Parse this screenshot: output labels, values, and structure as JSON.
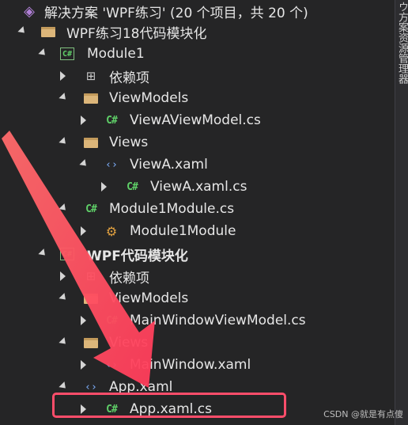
{
  "solution_title": "解决方案 'WPF练习' (20 个项目，共 20 个)",
  "side_panel_text": "ウ方案资源管理器",
  "tree": [
    {
      "id": "wpf18-project",
      "label": "WPF练习18代码模块化",
      "icon": "folder-icon",
      "arrow": "expanded",
      "bold": false
    },
    {
      "id": "module1-project",
      "label": "Module1",
      "icon": "csproj-icon",
      "arrow": "expanded",
      "bold": false
    },
    {
      "id": "module1-dependencies",
      "label": "依赖项",
      "icon": "dependencies-icon",
      "arrow": "collapsed",
      "bold": false
    },
    {
      "id": "module1-viewmodels",
      "label": "ViewModels",
      "icon": "folder-icon",
      "arrow": "expanded",
      "bold": false
    },
    {
      "id": "viewaviewmodel-cs",
      "label": "ViewAViewModel.cs",
      "icon": "csharp-icon",
      "arrow": "collapsed",
      "bold": false
    },
    {
      "id": "module1-views",
      "label": "Views",
      "icon": "folder-icon",
      "arrow": "expanded",
      "bold": false
    },
    {
      "id": "viewa-xaml",
      "label": "ViewA.xaml",
      "icon": "xaml-icon",
      "arrow": "expanded",
      "bold": false
    },
    {
      "id": "viewa-xaml-cs",
      "label": "ViewA.xaml.cs",
      "icon": "csharp-icon",
      "arrow": "collapsed",
      "bold": false
    },
    {
      "id": "module1module-cs",
      "label": "Module1Module.cs",
      "icon": "csharp-icon",
      "arrow": "expanded",
      "bold": false
    },
    {
      "id": "module1module-class",
      "label": "Module1Module",
      "icon": "module-icon",
      "arrow": "collapsed",
      "bold": false
    },
    {
      "id": "wpf-project",
      "label": "WPF代码模块化",
      "icon": "csproj-icon",
      "arrow": "expanded",
      "bold": true
    },
    {
      "id": "wpf-dependencies",
      "label": "依赖项",
      "icon": "dependencies-icon",
      "arrow": "collapsed",
      "bold": false
    },
    {
      "id": "wpf-viewmodels",
      "label": "ViewModels",
      "icon": "folder-icon",
      "arrow": "expanded",
      "bold": false
    },
    {
      "id": "mainwindowviewmodel-cs",
      "label": "MainWindowViewModel.cs",
      "icon": "csharp-icon",
      "arrow": "collapsed",
      "bold": false
    },
    {
      "id": "wpf-views",
      "label": "Views",
      "icon": "folder-icon",
      "arrow": "expanded",
      "bold": false
    },
    {
      "id": "mainwindow-xaml",
      "label": "MainWindow.xaml",
      "icon": "xaml-icon",
      "arrow": "collapsed",
      "bold": false
    },
    {
      "id": "app-xaml",
      "label": "App.xaml",
      "icon": "xaml-icon",
      "arrow": "expanded",
      "bold": false
    },
    {
      "id": "app-xaml-cs",
      "label": "App.xaml.cs",
      "icon": "csharp-icon",
      "arrow": "collapsed",
      "bold": false
    }
  ],
  "watermark": "CSDN @就是有点傻",
  "colors": {
    "highlight": "#ff4d6a",
    "background": "#252526",
    "folder": "#dcb67a",
    "csharp": "#5fd068"
  }
}
